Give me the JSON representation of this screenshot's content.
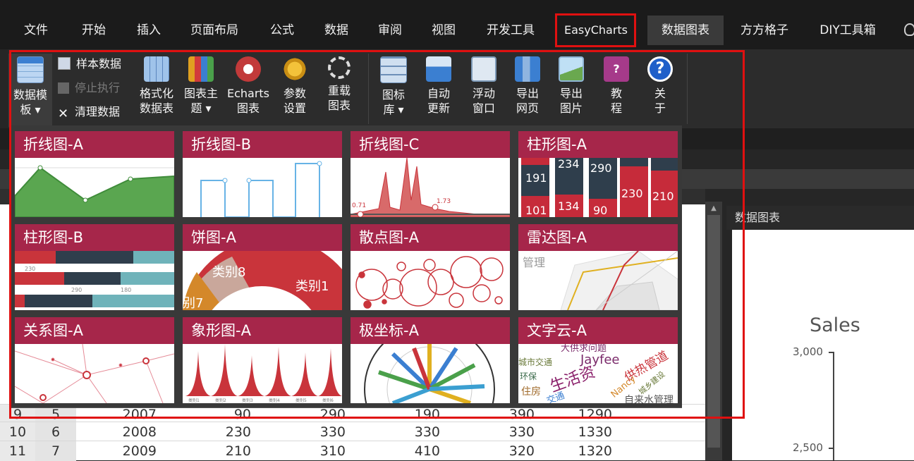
{
  "menubar": {
    "items": [
      "文件",
      "开始",
      "插入",
      "页面布局",
      "公式",
      "数据",
      "审阅",
      "视图",
      "开发工具",
      "EasyCharts",
      "数据图表",
      "方方格子",
      "DIY工具箱"
    ]
  },
  "ribbon": {
    "data_template": [
      "数据模",
      "板 ▾"
    ],
    "sample_data": "样本数据",
    "stop_exec": "停止执行",
    "clear_data": "清理数据",
    "format_table": [
      "格式化",
      "数据表"
    ],
    "chart_theme": [
      "图表主",
      "题 ▾"
    ],
    "echarts": [
      "Echarts",
      "图表"
    ],
    "params": [
      "参数",
      "设置"
    ],
    "reload": [
      "重载",
      "图表"
    ],
    "icon_lib": [
      "图标",
      "库 ▾"
    ],
    "auto_update": [
      "自动",
      "更新"
    ],
    "float_window": [
      "浮动",
      "窗口"
    ],
    "export_web": [
      "导出",
      "网页"
    ],
    "export_image": [
      "导出",
      "图片"
    ],
    "tutorial": [
      "教",
      "程"
    ],
    "about": [
      "关",
      "于"
    ]
  },
  "gallery": {
    "tiles": [
      "折线图-A",
      "折线图-B",
      "折线图-C",
      "柱形图-A",
      "柱形图-B",
      "饼图-A",
      "散点图-A",
      "雷达图-A",
      "关系图-A",
      "象形图-A",
      "极坐标-A",
      "文字云-A"
    ],
    "labels": {
      "c_left": "0.71",
      "c_right": "1.73",
      "bar_a": [
        "191",
        "234",
        "290",
        "101",
        "134",
        "90",
        "230",
        "210"
      ],
      "bar_b": [
        "230",
        "290",
        "180"
      ],
      "pie": [
        "类别8",
        "类别1",
        "别7"
      ],
      "radar": "管理",
      "picto": [
        "类别1",
        "类别2",
        "类别3",
        "类别4",
        "类别5",
        "类别6"
      ],
      "cloud": [
        "大供求问题",
        "Jayfee",
        "城市交通",
        "生活资",
        "供热管道",
        "Nancy",
        "城乡建设",
        "自来水管理",
        "环保",
        "住房",
        "交通"
      ]
    }
  },
  "sheet": {
    "rows": [
      {
        "num": "9",
        "id": "5",
        "cells": [
          "2007",
          "90",
          "290",
          "190",
          "390",
          "1290"
        ]
      },
      {
        "num": "10",
        "id": "6",
        "cells": [
          "2008",
          "230",
          "330",
          "330",
          "330",
          "1330"
        ]
      },
      {
        "num": "11",
        "id": "7",
        "cells": [
          "2009",
          "210",
          "310",
          "410",
          "320",
          "1320"
        ]
      }
    ]
  },
  "panel": {
    "header": "数据图表",
    "chart_title": "Sales",
    "yticks": [
      "3,000",
      "2,500"
    ]
  },
  "colors": {
    "tile_header": "#a6264a",
    "highlight_box": "#e01010",
    "accent_green": "#5aa650",
    "accent_red": "#c9343b"
  }
}
